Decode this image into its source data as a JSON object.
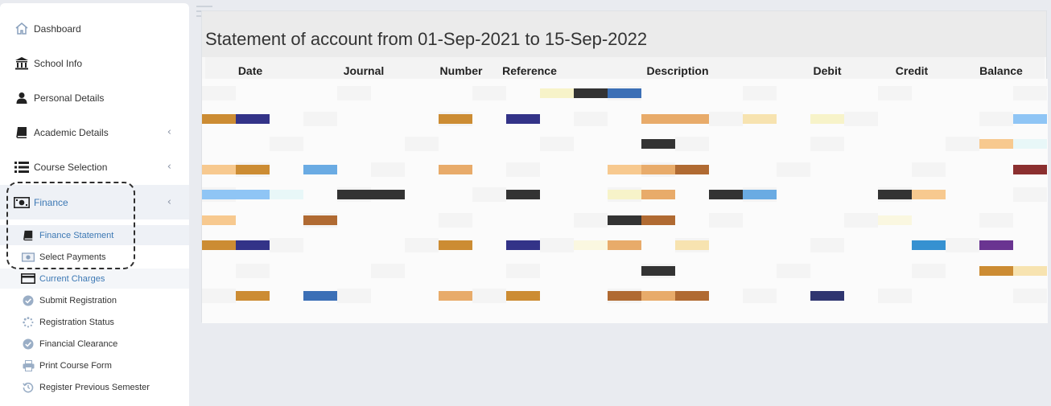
{
  "sidebar": {
    "items": [
      {
        "label": "Dashboard",
        "icon": "home-icon",
        "chevron": false
      },
      {
        "label": "School Info",
        "icon": "bank-icon",
        "chevron": false
      },
      {
        "label": "Personal Details",
        "icon": "user-icon",
        "chevron": false
      },
      {
        "label": "Academic Details",
        "icon": "book-icon",
        "chevron": true
      },
      {
        "label": "Course Selection",
        "icon": "list-icon",
        "chevron": true
      },
      {
        "label": "Finance",
        "icon": "money-icon",
        "chevron": true,
        "active": true
      }
    ],
    "chevron_glyph": "‹",
    "sub_items": [
      {
        "label": "Finance Statement",
        "icon": "book-icon",
        "state": "highlighted"
      },
      {
        "label": "Select Payments",
        "icon": "money-icon",
        "state": "normal"
      },
      {
        "label": "Current Charges",
        "icon": "credit-card-icon",
        "state": "selected"
      },
      {
        "label": "Submit Registration",
        "icon": "check-circle-icon",
        "state": "normal"
      },
      {
        "label": "Registration Status",
        "icon": "spinner-icon",
        "state": "normal"
      },
      {
        "label": "Financial Clearance",
        "icon": "check-circle-icon",
        "state": "normal"
      },
      {
        "label": "Print Course Form",
        "icon": "print-icon",
        "state": "normal"
      },
      {
        "label": "Register Previous Semester",
        "icon": "history-icon",
        "state": "normal"
      }
    ]
  },
  "main": {
    "title": "Statement of account from 01-Sep-2021 to 15-Sep-2022",
    "columns": [
      "Date",
      "Journal",
      "Number",
      "Reference",
      "Description",
      "Debit",
      "Credit",
      "Balance"
    ]
  },
  "colors": {
    "accent": "#3c78b4",
    "page_bg": "#e9ebf0",
    "gold": "#cc8c33",
    "navy": "#333388",
    "dark": "#333333",
    "blue": "#3b6fb6",
    "cream": "#f7f3c9",
    "tan": "#e8ab6a",
    "peach": "#f7c98f",
    "light_blue": "#6aabe3",
    "sky": "#8fc5f5",
    "brown": "#b06a32",
    "maroon": "#8b2f2f",
    "purple": "#6a3491",
    "ice": "#e8f7f8",
    "bright_blue": "#3691d1",
    "dark_navy": "#2f3570"
  },
  "redacted_rows": [
    [
      [
        10,
        12,
        "cream"
      ],
      [
        11,
        12,
        "dark"
      ],
      [
        12,
        12,
        "blue"
      ]
    ],
    [
      [
        0,
        12,
        "gold"
      ],
      [
        1,
        12,
        "navy"
      ],
      [
        7,
        12,
        "gold"
      ],
      [
        9,
        12,
        "navy"
      ],
      [
        13,
        12,
        "tan"
      ],
      [
        14,
        12,
        "tan"
      ],
      [
        16,
        12,
        "cream2"
      ],
      [
        18,
        12,
        "cream"
      ],
      [
        24,
        12,
        "sky"
      ]
    ],
    [
      [
        13,
        12,
        "dark"
      ],
      [
        23,
        12,
        "peach"
      ],
      [
        24,
        12,
        "ice"
      ]
    ],
    [
      [
        0,
        12,
        "peach"
      ],
      [
        1,
        12,
        "gold"
      ],
      [
        3,
        12,
        "light_blue"
      ],
      [
        7,
        12,
        "tan"
      ],
      [
        12,
        12,
        "peach"
      ],
      [
        13,
        12,
        "tan"
      ],
      [
        14,
        12,
        "brown"
      ],
      [
        24,
        12,
        "maroon"
      ]
    ],
    [
      [
        0,
        12,
        "sky"
      ],
      [
        1,
        12,
        "sky"
      ],
      [
        2,
        12,
        "ice"
      ],
      [
        4,
        12,
        "dark"
      ],
      [
        5,
        12,
        "dark"
      ],
      [
        9,
        12,
        "dark"
      ],
      [
        12,
        12,
        "cream"
      ],
      [
        13,
        12,
        "tan"
      ],
      [
        15,
        12,
        "dark"
      ],
      [
        16,
        12,
        "light_blue"
      ],
      [
        20,
        12,
        "dark"
      ],
      [
        21,
        12,
        "peach"
      ]
    ],
    [
      [
        0,
        12,
        "peach"
      ],
      [
        3,
        12,
        "brown"
      ],
      [
        12,
        12,
        "dark"
      ],
      [
        13,
        12,
        "brown"
      ],
      [
        20,
        12,
        "cream3"
      ]
    ],
    [
      [
        0,
        12,
        "gold"
      ],
      [
        1,
        12,
        "navy"
      ],
      [
        7,
        12,
        "gold"
      ],
      [
        9,
        12,
        "navy"
      ],
      [
        11,
        12,
        "cream3"
      ],
      [
        12,
        12,
        "tan"
      ],
      [
        14,
        12,
        "cream2"
      ],
      [
        21,
        12,
        "bright_blue"
      ],
      [
        23,
        12,
        "purple"
      ]
    ],
    [
      [
        13,
        12,
        "dark"
      ],
      [
        23,
        12,
        "gold"
      ],
      [
        24,
        12,
        "cream2"
      ]
    ],
    [
      [
        1,
        12,
        "gold"
      ],
      [
        3,
        12,
        "blue"
      ],
      [
        7,
        12,
        "tan"
      ],
      [
        9,
        12,
        "gold"
      ],
      [
        12,
        12,
        "brown"
      ],
      [
        13,
        12,
        "tan"
      ],
      [
        14,
        12,
        "brown"
      ],
      [
        18,
        12,
        "dark_navy"
      ]
    ]
  ]
}
